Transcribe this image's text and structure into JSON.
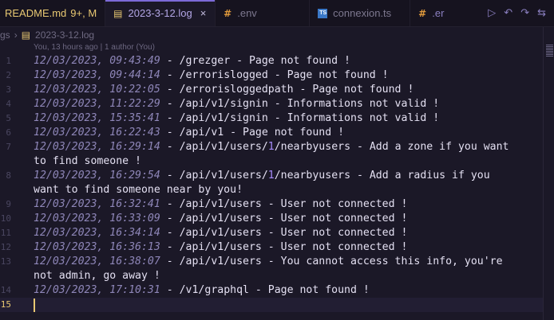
{
  "tabs": [
    {
      "name": "tab-readme",
      "icon": "markdown-icon",
      "label": "README.md",
      "badge": "9+, M"
    },
    {
      "name": "tab-log",
      "icon": "log-icon",
      "label": "2023-3-12.log",
      "close": "×",
      "active": true
    },
    {
      "name": "tab-env",
      "icon": "hash-icon",
      "label": ".env"
    },
    {
      "name": "tab-connexion",
      "icon": "ts-icon",
      "label": "connexion.ts"
    },
    {
      "name": "tab-er",
      "icon": "hash-icon",
      "label": ".er"
    }
  ],
  "actions": {
    "run": "▷",
    "prev": "↶",
    "next": "↷",
    "more": "⇆"
  },
  "breadcrumb": {
    "parent": "gs",
    "file": "2023-3-12.log"
  },
  "codelens": "You, 13 hours ago | 1 author (You)",
  "lines": [
    {
      "n": "1",
      "date": "12/03/2023, 09:43:49",
      "pre": " - /grezger - Page not found !"
    },
    {
      "n": "2",
      "date": "12/03/2023, 09:44:14",
      "pre": " - /errorislogged - Page not found !"
    },
    {
      "n": "3",
      "date": "12/03/2023, 10:22:05",
      "pre": " - /errorisloggedpath - Page not found !"
    },
    {
      "n": "4",
      "date": "12/03/2023, 11:22:29",
      "pre": " - /api/v1/signin - Informations not valid !"
    },
    {
      "n": "5",
      "date": "12/03/2023, 15:35:41",
      "pre": " - /api/v1/signin - Informations not valid !"
    },
    {
      "n": "6",
      "date": "12/03/2023, 16:22:43",
      "pre": " - /api/v1 - Page not found !"
    },
    {
      "n": "7",
      "date": "12/03/2023, 16:29:14",
      "a": " - /api/v1/users/",
      "num": "1",
      "b": "/nearbyusers - Add a zone if you want",
      "wrap": "to find someone !"
    },
    {
      "n": "8",
      "date": "12/03/2023, 16:29:54",
      "a": " - /api/v1/users/",
      "num": "1",
      "b": "/nearbyusers - Add a radius if you",
      "wrap": "want to find someone near by you!"
    },
    {
      "n": "9",
      "date": "12/03/2023, 16:32:41",
      "pre": " - /api/v1/users - User not connected !"
    },
    {
      "n": "10",
      "date": "12/03/2023, 16:33:09",
      "pre": " - /api/v1/users - User not connected !"
    },
    {
      "n": "11",
      "date": "12/03/2023, 16:34:14",
      "pre": " - /api/v1/users - User not connected !"
    },
    {
      "n": "12",
      "date": "12/03/2023, 16:36:13",
      "pre": " - /api/v1/users - User not connected !"
    },
    {
      "n": "13",
      "date": "12/03/2023, 16:38:07",
      "pre": " - /api/v1/users - You cannot access this info, you're",
      "wrap": "not admin, go away !"
    },
    {
      "n": "14",
      "date": "12/03/2023, 17:10:31",
      "pre": " - /v1/graphql - Page not found !"
    },
    {
      "n": "15",
      "date": "",
      "pre": ""
    }
  ]
}
